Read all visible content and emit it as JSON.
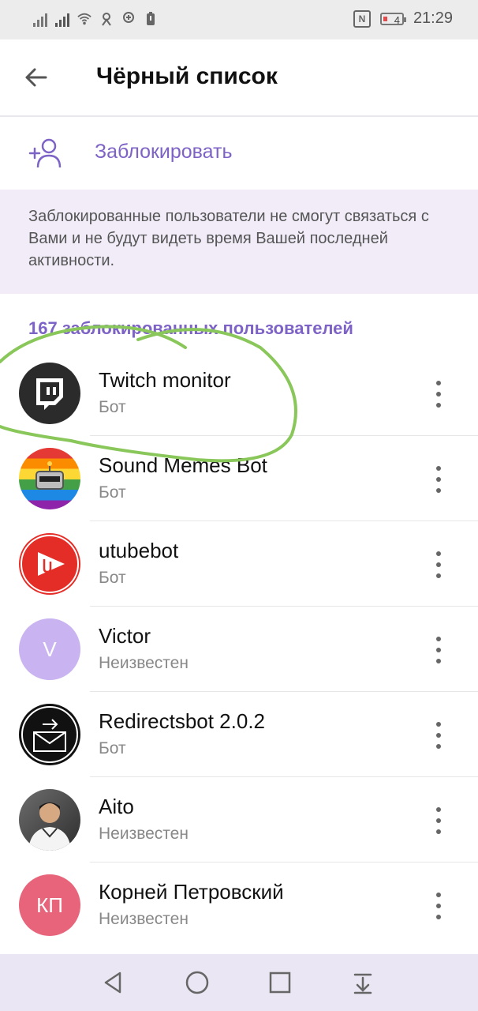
{
  "status_bar": {
    "time": "21:29",
    "battery": "4"
  },
  "header": {
    "title": "Чёрный список"
  },
  "block_action": {
    "label": "Заблокировать"
  },
  "info": {
    "text": "Заблокированные пользователи не смогут связаться с Вами и не будут видеть время Вашей последней активности."
  },
  "section": {
    "title": "167 заблокированных пользователей"
  },
  "blocked_users": [
    {
      "name": "Twitch monitor",
      "status": "Бот"
    },
    {
      "name": "Sound Memes Bot",
      "status": "Бот"
    },
    {
      "name": "utubebot",
      "status": "Бот"
    },
    {
      "name": "Victor",
      "status": "Неизвестен",
      "initials": "V"
    },
    {
      "name": "Redirectsbot 2.0.2",
      "status": "Бот"
    },
    {
      "name": "Aito",
      "status": "Неизвестен"
    },
    {
      "name": "Корней Петровский",
      "status": "Неизвестен",
      "initials": "КП"
    }
  ],
  "colors": {
    "accent": "#7e63c7",
    "info_bg": "#f1ecf8",
    "victor_avatar": "#c9b3f0",
    "kp_avatar": "#e8647a"
  }
}
